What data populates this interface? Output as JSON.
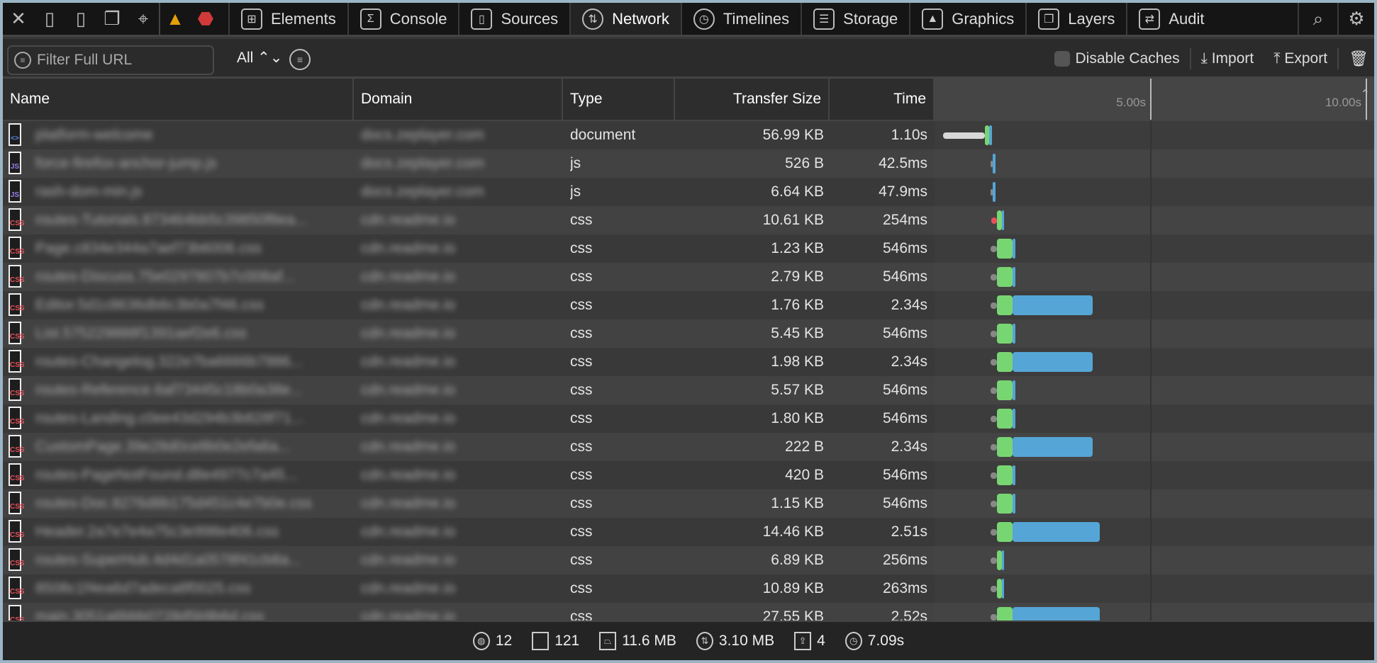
{
  "toolbar": {
    "icons": [
      "close-icon",
      "dock-left-icon",
      "dock-right-icon",
      "detach-icon",
      "inspect-crosshair-icon"
    ],
    "warning_icon": "warning-icon",
    "error_icon": "error-icon",
    "tabs": [
      {
        "label": "Elements",
        "icon": "elements-icon",
        "glyph": "⊞"
      },
      {
        "label": "Console",
        "icon": "console-icon",
        "glyph": "Σ"
      },
      {
        "label": "Sources",
        "icon": "sources-icon",
        "glyph": "▯"
      },
      {
        "label": "Network",
        "icon": "network-icon",
        "glyph": "⇅",
        "active": true
      },
      {
        "label": "Timelines",
        "icon": "timelines-icon",
        "glyph": "◷"
      },
      {
        "label": "Storage",
        "icon": "storage-icon",
        "glyph": "☰"
      },
      {
        "label": "Graphics",
        "icon": "graphics-icon",
        "glyph": "▲"
      },
      {
        "label": "Layers",
        "icon": "layers-icon",
        "glyph": "❐"
      },
      {
        "label": "Audit",
        "icon": "audit-icon",
        "glyph": "⇄"
      }
    ]
  },
  "filterbar": {
    "placeholder": "Filter Full URL",
    "type_filter": "All ⌃⌄",
    "disable_caches": "Disable Caches",
    "disable_caches_checked": false,
    "import": "Import",
    "export": "Export"
  },
  "columns": {
    "name": "Name",
    "domain": "Domain",
    "type": "Type",
    "size": "Transfer Size",
    "time": "Time",
    "ticks": [
      "5.00s",
      "10.00s"
    ]
  },
  "rows": [
    {
      "name": "platform-welcome",
      "domain": "docs.zeplayer.com",
      "kind": "doc",
      "type": "document",
      "size": "56.99 KB",
      "time": "1.10s",
      "bars": [
        {
          "c": "#d8d8d8",
          "s": 0.2,
          "d": 0.97,
          "thin": true
        },
        {
          "c": "#78d672",
          "s": 1.17,
          "d": 0.1
        },
        {
          "c": "#55a6d6",
          "s": 1.27,
          "d": 0.07
        }
      ]
    },
    {
      "name": "force-firefox-anchor-jump.js",
      "domain": "docs.zeplayer.com",
      "kind": "js",
      "type": "js",
      "size": "526 B",
      "time": "42.5ms",
      "bars": [
        {
          "c": "#888",
          "s": 1.3,
          "d": 0.05,
          "thin": true
        },
        {
          "c": "#55a6d6",
          "s": 1.35,
          "d": 0.06
        }
      ]
    },
    {
      "name": "rash-dom-min.js",
      "domain": "docs.zeplayer.com",
      "kind": "js",
      "type": "js",
      "size": "6.64 KB",
      "time": "47.9ms",
      "bars": [
        {
          "c": "#888",
          "s": 1.3,
          "d": 0.05,
          "thin": true
        },
        {
          "c": "#55a6d6",
          "s": 1.35,
          "d": 0.06
        }
      ]
    },
    {
      "name": "routes-Tutorials.873464bb5c39850f8ea...",
      "domain": "cdn.readme.io",
      "kind": "css",
      "type": "css",
      "size": "10.61 KB",
      "time": "254ms",
      "bars": [
        {
          "c": "#e8505b",
          "s": 1.32,
          "d": 0.13,
          "thin": true
        },
        {
          "c": "#78d672",
          "s": 1.45,
          "d": 0.12
        },
        {
          "c": "#55a6d6",
          "s": 1.57,
          "d": 0.05
        }
      ]
    },
    {
      "name": "Page.c834e344a7aef73b6006.css",
      "domain": "cdn.readme.io",
      "kind": "css",
      "type": "css",
      "size": "1.23 KB",
      "time": "546ms",
      "bars": [
        {
          "c": "#888",
          "s": 1.3,
          "d": 0.15,
          "thin": true
        },
        {
          "c": "#78d672",
          "s": 1.45,
          "d": 0.36
        },
        {
          "c": "#55a6d6",
          "s": 1.81,
          "d": 0.07
        }
      ]
    },
    {
      "name": "routes-Discuss.75e0297807b7c008af...",
      "domain": "cdn.readme.io",
      "kind": "css",
      "type": "css",
      "size": "2.79 KB",
      "time": "546ms",
      "bars": [
        {
          "c": "#888",
          "s": 1.3,
          "d": 0.15,
          "thin": true
        },
        {
          "c": "#78d672",
          "s": 1.45,
          "d": 0.36
        },
        {
          "c": "#55a6d6",
          "s": 1.81,
          "d": 0.07
        }
      ]
    },
    {
      "name": "Editor.5d1c8636db6c3b0a7f46.css",
      "domain": "cdn.readme.io",
      "kind": "css",
      "type": "css",
      "size": "1.76 KB",
      "time": "2.34s",
      "bars": [
        {
          "c": "#888",
          "s": 1.3,
          "d": 0.15,
          "thin": true
        },
        {
          "c": "#78d672",
          "s": 1.45,
          "d": 0.36
        },
        {
          "c": "#55a6d6",
          "s": 1.81,
          "d": 1.86
        }
      ]
    },
    {
      "name": "List.575229888f1391aef2e6.css",
      "domain": "cdn.readme.io",
      "kind": "css",
      "type": "css",
      "size": "5.45 KB",
      "time": "546ms",
      "bars": [
        {
          "c": "#888",
          "s": 1.3,
          "d": 0.15,
          "thin": true
        },
        {
          "c": "#78d672",
          "s": 1.45,
          "d": 0.36
        },
        {
          "c": "#55a6d6",
          "s": 1.81,
          "d": 0.07
        }
      ]
    },
    {
      "name": "routes-Changelog.322e7ba6666b7886...",
      "domain": "cdn.readme.io",
      "kind": "css",
      "type": "css",
      "size": "1.98 KB",
      "time": "2.34s",
      "bars": [
        {
          "c": "#888",
          "s": 1.3,
          "d": 0.15,
          "thin": true
        },
        {
          "c": "#78d672",
          "s": 1.45,
          "d": 0.36
        },
        {
          "c": "#55a6d6",
          "s": 1.81,
          "d": 1.86
        }
      ]
    },
    {
      "name": "routes-Reference.6af73445c18b0a38e...",
      "domain": "cdn.readme.io",
      "kind": "css",
      "type": "css",
      "size": "5.57 KB",
      "time": "546ms",
      "bars": [
        {
          "c": "#888",
          "s": 1.3,
          "d": 0.15,
          "thin": true
        },
        {
          "c": "#78d672",
          "s": 1.45,
          "d": 0.36
        },
        {
          "c": "#55a6d6",
          "s": 1.81,
          "d": 0.07
        }
      ]
    },
    {
      "name": "routes-Landing.c0ee43d294b3b828f71...",
      "domain": "cdn.readme.io",
      "kind": "css",
      "type": "css",
      "size": "1.80 KB",
      "time": "546ms",
      "bars": [
        {
          "c": "#888",
          "s": 1.3,
          "d": 0.15,
          "thin": true
        },
        {
          "c": "#78d672",
          "s": 1.45,
          "d": 0.36
        },
        {
          "c": "#55a6d6",
          "s": 1.81,
          "d": 0.07
        }
      ]
    },
    {
      "name": "CustomPage.39e28d0ce8b0e2efa6a...",
      "domain": "cdn.readme.io",
      "kind": "css",
      "type": "css",
      "size": "222 B",
      "time": "2.34s",
      "bars": [
        {
          "c": "#888",
          "s": 1.3,
          "d": 0.15,
          "thin": true
        },
        {
          "c": "#78d672",
          "s": 1.45,
          "d": 0.36
        },
        {
          "c": "#55a6d6",
          "s": 1.81,
          "d": 1.86
        }
      ]
    },
    {
      "name": "routes-PageNotFound.d8e4977c7a45...",
      "domain": "cdn.readme.io",
      "kind": "css",
      "type": "css",
      "size": "420 B",
      "time": "546ms",
      "bars": [
        {
          "c": "#888",
          "s": 1.3,
          "d": 0.15,
          "thin": true
        },
        {
          "c": "#78d672",
          "s": 1.45,
          "d": 0.36
        },
        {
          "c": "#55a6d6",
          "s": 1.81,
          "d": 0.07
        }
      ]
    },
    {
      "name": "routes-Doc.8276d8b175d451c4e7b0e.css",
      "domain": "cdn.readme.io",
      "kind": "css",
      "type": "css",
      "size": "1.15 KB",
      "time": "546ms",
      "bars": [
        {
          "c": "#888",
          "s": 1.3,
          "d": 0.15,
          "thin": true
        },
        {
          "c": "#78d672",
          "s": 1.45,
          "d": 0.36
        },
        {
          "c": "#55a6d6",
          "s": 1.81,
          "d": 0.07
        }
      ]
    },
    {
      "name": "Header.2a7e7e4a75c3e998e406.css",
      "domain": "cdn.readme.io",
      "kind": "css",
      "type": "css",
      "size": "14.46 KB",
      "time": "2.51s",
      "bars": [
        {
          "c": "#888",
          "s": 1.3,
          "d": 0.15,
          "thin": true
        },
        {
          "c": "#78d672",
          "s": 1.45,
          "d": 0.36
        },
        {
          "c": "#55a6d6",
          "s": 1.81,
          "d": 2.02
        }
      ]
    },
    {
      "name": "routes-SuperHub.4d4d1a0578f41cb8a...",
      "domain": "cdn.readme.io",
      "kind": "css",
      "type": "css",
      "size": "6.89 KB",
      "time": "256ms",
      "bars": [
        {
          "c": "#888",
          "s": 1.3,
          "d": 0.15,
          "thin": true
        },
        {
          "c": "#78d672",
          "s": 1.45,
          "d": 0.12
        },
        {
          "c": "#55a6d6",
          "s": 1.57,
          "d": 0.05
        }
      ]
    },
    {
      "name": "8508c1f4ea6d7adeca8f0025.css",
      "domain": "cdn.readme.io",
      "kind": "css",
      "type": "css",
      "size": "10.89 KB",
      "time": "263ms",
      "bars": [
        {
          "c": "#888",
          "s": 1.3,
          "d": 0.15,
          "thin": true
        },
        {
          "c": "#78d672",
          "s": 1.45,
          "d": 0.12
        },
        {
          "c": "#55a6d6",
          "s": 1.57,
          "d": 0.05
        }
      ]
    },
    {
      "name": "main.3051a6bbb0728d5b9b6d.css",
      "domain": "cdn.readme.io",
      "kind": "css",
      "type": "css",
      "size": "27.55 KB",
      "time": "2.52s",
      "bars": [
        {
          "c": "#888",
          "s": 1.3,
          "d": 0.15,
          "thin": true
        },
        {
          "c": "#78d672",
          "s": 1.45,
          "d": 0.36
        },
        {
          "c": "#55a6d6",
          "s": 1.81,
          "d": 2.02
        }
      ]
    }
  ],
  "status": [
    {
      "icon": "domains-globe-icon",
      "glyph": "◍",
      "value": "12"
    },
    {
      "icon": "resources-file-icon",
      "glyph": "",
      "value": "121"
    },
    {
      "icon": "weight-size-icon",
      "glyph": "⏢",
      "value": "11.6 MB"
    },
    {
      "icon": "transferred-icon",
      "glyph": "⇅",
      "value": "3.10 MB"
    },
    {
      "icon": "redirects-icon",
      "glyph": "⇪",
      "value": "4"
    },
    {
      "icon": "time-clock-icon",
      "glyph": "◷",
      "value": "7.09s"
    }
  ],
  "colors": {
    "waiting": "#888888",
    "receive": "#78d672",
    "download": "#55a6d6",
    "blocked": "#e8505b",
    "accent_warning": "#e3a008",
    "accent_error": "#d03a3a"
  }
}
